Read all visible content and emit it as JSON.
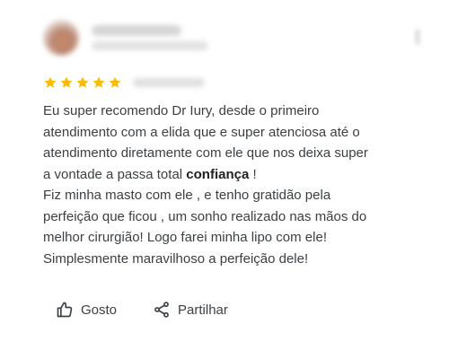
{
  "review": {
    "rating": 5,
    "rating_max": 5,
    "star_color": "#fbbc04",
    "line1": "Eu super recomendo Dr Iury, desde o primeiro",
    "line2": "atendimento com a elida que e super atenciosa até o",
    "line3": "atendimento diretamente com ele que nos deixa super",
    "line4_pre": "a vontade a passa total ",
    "line4_bold": "confiança",
    "line4_post": " !",
    "line5": "Fiz minha masto com ele , e tenho gratidão pela",
    "line6": "perfeição que ficou , um sonho realizado nas mãos do",
    "line7": "melhor cirurgião! Logo farei minha lipo com ele!",
    "line8": "Simplesmente maravilhoso a perfeição dele!"
  },
  "actions": {
    "like_label": "Gosto",
    "like_icon": "thumbs-up-icon",
    "share_label": "Partilhar",
    "share_icon": "share-icon"
  }
}
